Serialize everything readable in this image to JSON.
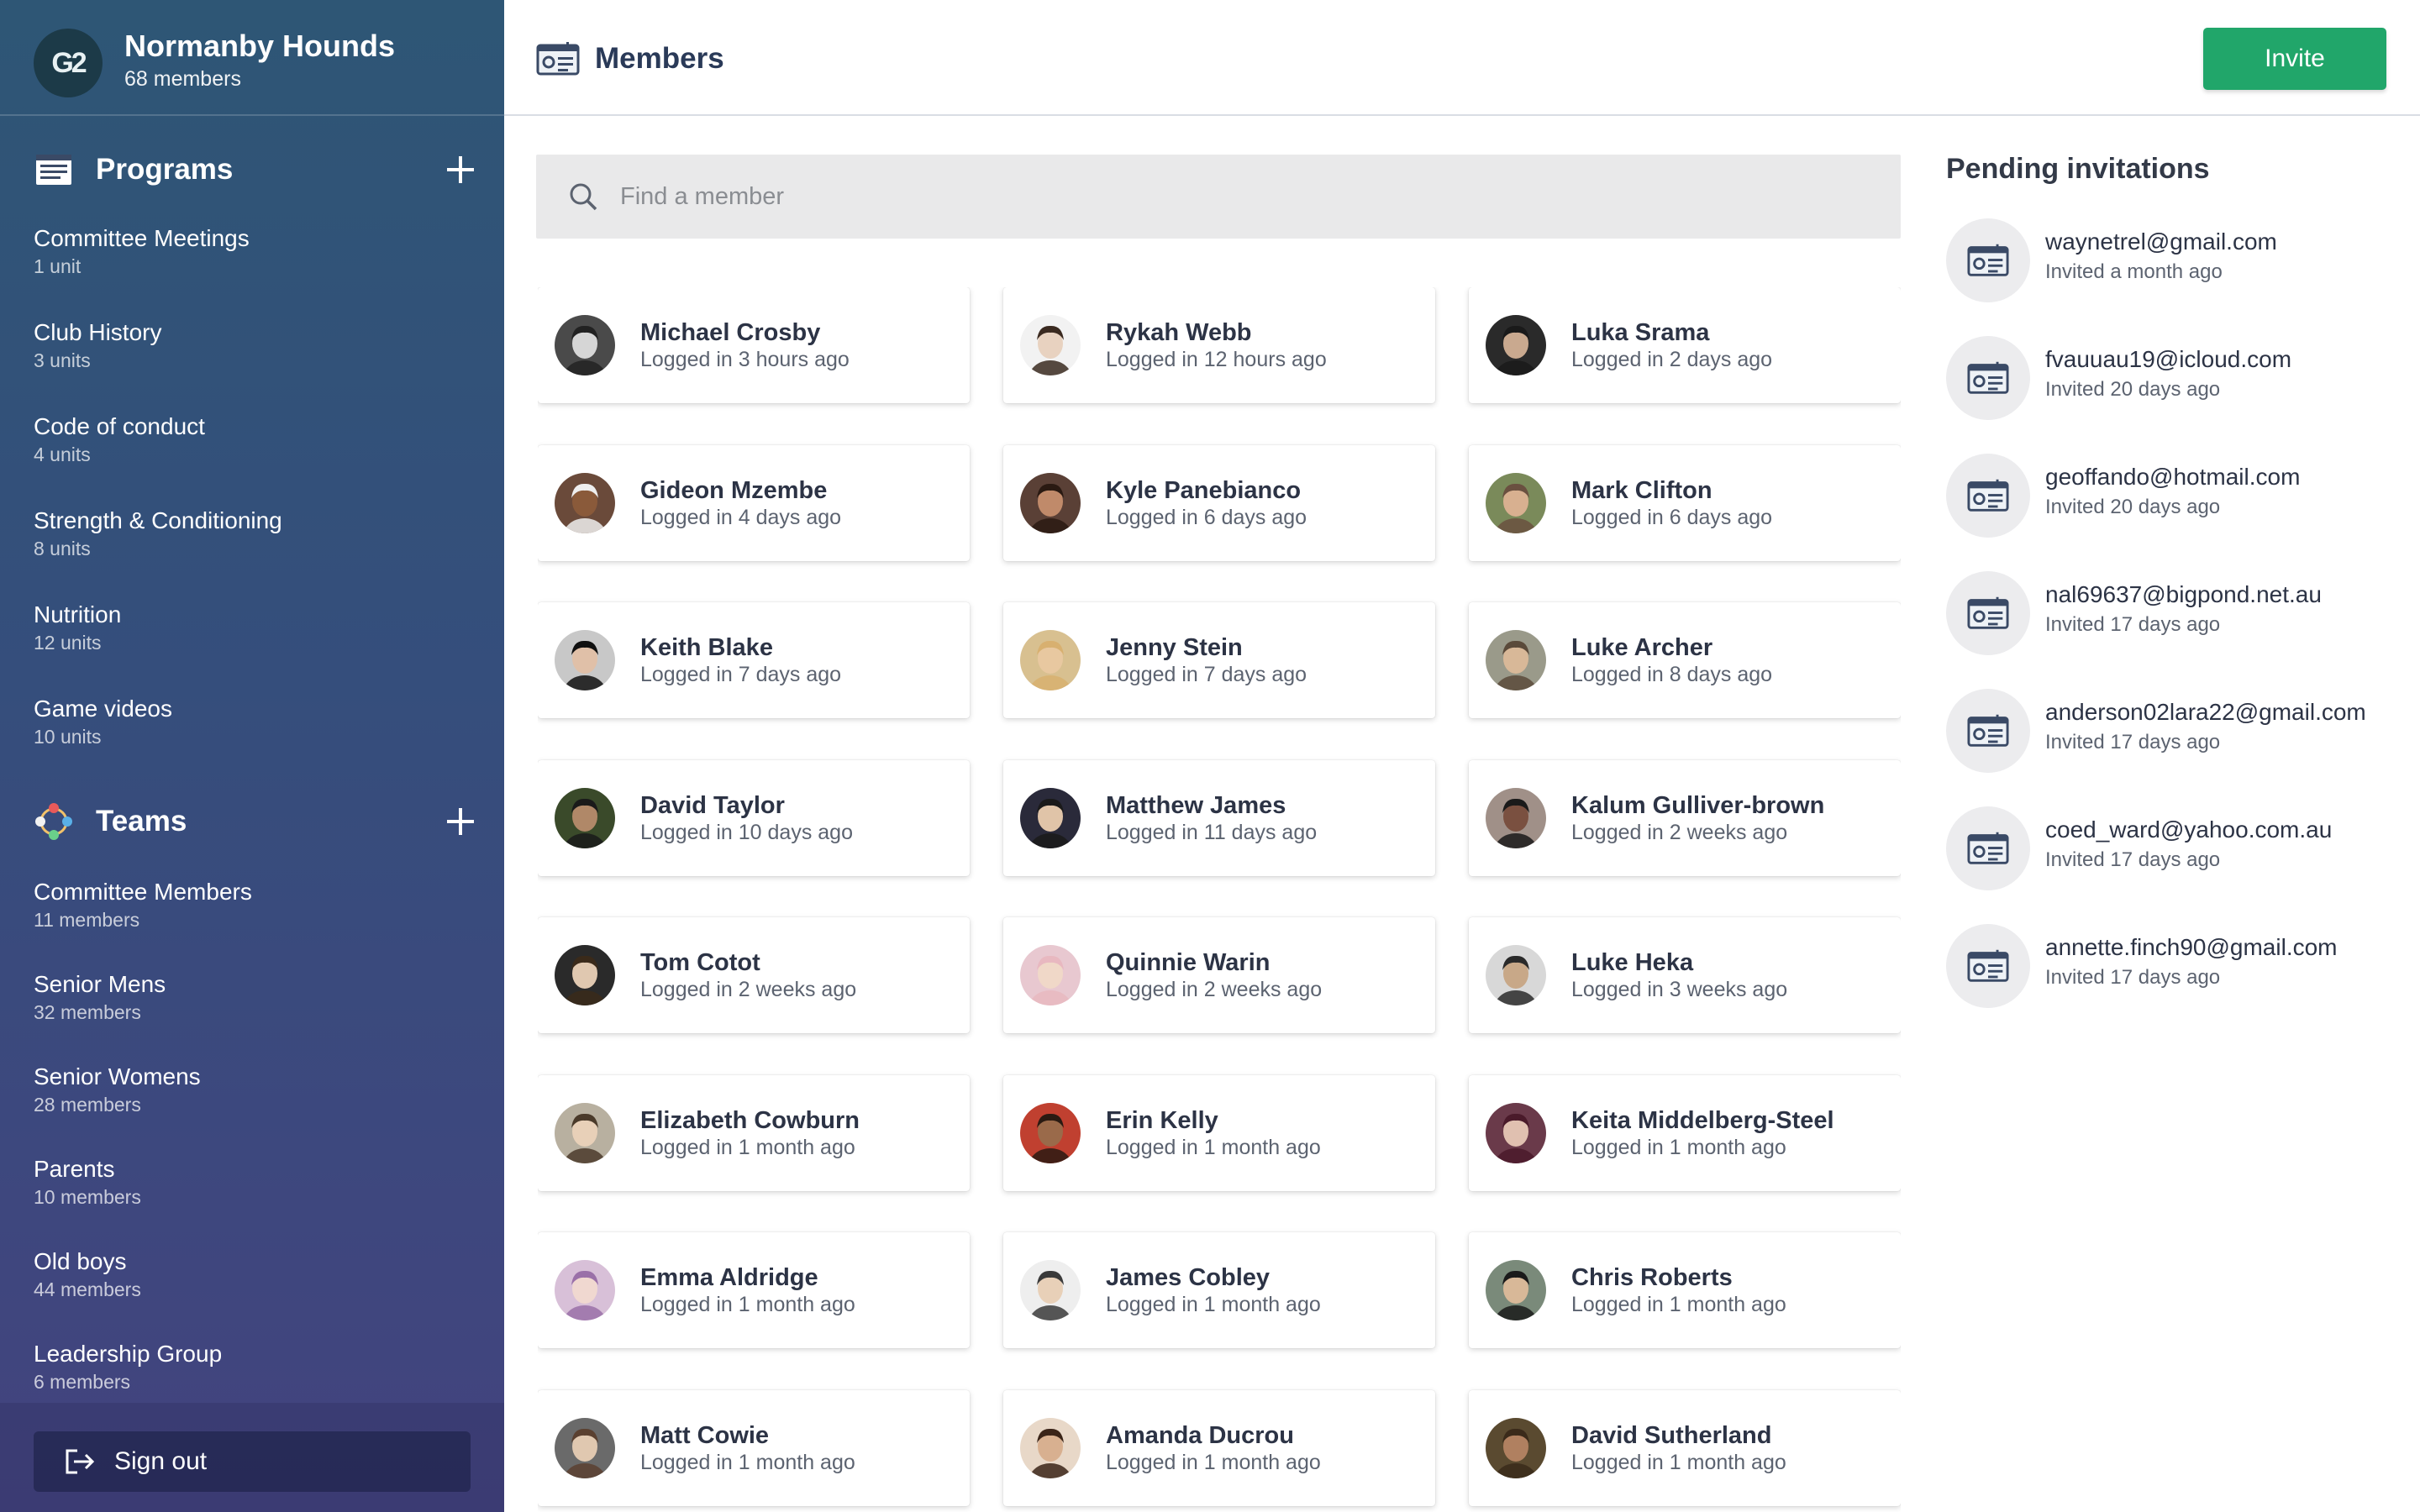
{
  "org": {
    "logo_text": "G2",
    "name": "Normanby Hounds",
    "member_count": "68 members"
  },
  "programs": {
    "title": "Programs",
    "items": [
      {
        "label": "Committee Meetings",
        "sub": "1 unit"
      },
      {
        "label": "Club History",
        "sub": "3 units"
      },
      {
        "label": "Code of conduct",
        "sub": "4 units"
      },
      {
        "label": "Strength & Conditioning",
        "sub": "8 units"
      },
      {
        "label": "Nutrition",
        "sub": "12 units"
      },
      {
        "label": "Game videos",
        "sub": "10 units"
      }
    ]
  },
  "teams": {
    "title": "Teams",
    "items": [
      {
        "label": "Committee Members",
        "sub": "11 members"
      },
      {
        "label": "Senior Mens",
        "sub": "32 members"
      },
      {
        "label": "Senior Womens",
        "sub": "28 members"
      },
      {
        "label": "Parents",
        "sub": "10 members"
      },
      {
        "label": "Old boys",
        "sub": "44 members"
      },
      {
        "label": "Leadership Group",
        "sub": "6 members"
      }
    ]
  },
  "signout_label": "Sign out",
  "header": {
    "title": "Members",
    "invite_label": "Invite"
  },
  "search": {
    "placeholder": "Find a member"
  },
  "members": [
    {
      "name": "Michael Crosby",
      "sub": "Logged in 3 hours ago",
      "skin": "#d6d6d6",
      "hair": "#222222",
      "bg": "#4a4a4a"
    },
    {
      "name": "Rykah Webb",
      "sub": "Logged in 12 hours ago",
      "skin": "#e8d2c0",
      "hair": "#3a2a20",
      "bg": "#f2f2f2"
    },
    {
      "name": "Luka Srama",
      "sub": "Logged in 2 days ago",
      "skin": "#c9a98f",
      "hair": "#1a1a1a",
      "bg": "#2a2a2a"
    },
    {
      "name": "Gideon Mzembe",
      "sub": "Logged in 4 days ago",
      "skin": "#8a5a3a",
      "hair": "#eeeeee",
      "bg": "#6a4a3a"
    },
    {
      "name": "Kyle Panebianco",
      "sub": "Logged in 6 days ago",
      "skin": "#c08a6a",
      "hair": "#2a1a12",
      "bg": "#5a4036"
    },
    {
      "name": "Mark Clifton",
      "sub": "Logged in 6 days ago",
      "skin": "#d8b090",
      "hair": "#6a5040",
      "bg": "#7a8a5a"
    },
    {
      "name": "Keith Blake",
      "sub": "Logged in 7 days ago",
      "skin": "#e0c0a8",
      "hair": "#101010",
      "bg": "#c8c8c8"
    },
    {
      "name": "Jenny Stein",
      "sub": "Logged in 7 days ago",
      "skin": "#e8c8a0",
      "hair": "#d8b070",
      "bg": "#d8c090"
    },
    {
      "name": "Luke Archer",
      "sub": "Logged in 8 days ago",
      "skin": "#d8b898",
      "hair": "#5a4a3a",
      "bg": "#9a9a8a"
    },
    {
      "name": "David Taylor",
      "sub": "Logged in 10 days ago",
      "skin": "#b08868",
      "hair": "#1a1a1a",
      "bg": "#3a4a2a"
    },
    {
      "name": "Matthew James",
      "sub": "Logged in 11 days ago",
      "skin": "#e0c4a8",
      "hair": "#1a1a1a",
      "bg": "#2a2a3a"
    },
    {
      "name": "Kalum Gulliver-brown",
      "sub": "Logged in 2 weeks ago",
      "skin": "#7a5040",
      "hair": "#1a1a1a",
      "bg": "#a09088"
    },
    {
      "name": "Tom Cotot",
      "sub": "Logged in 2 weeks ago",
      "skin": "#e0c8b0",
      "hair": "#3a2a1a",
      "bg": "#2a2a2a"
    },
    {
      "name": "Quinnie Warin",
      "sub": "Logged in 2 weeks ago",
      "skin": "#f0d8c8",
      "hair": "#e8b8c0",
      "bg": "#e8c8d0"
    },
    {
      "name": "Luke Heka",
      "sub": "Logged in 3 weeks ago",
      "skin": "#c8a888",
      "hair": "#2a2a2a",
      "bg": "#d8d8d8"
    },
    {
      "name": "Elizabeth Cowburn",
      "sub": "Logged in 1 month ago",
      "skin": "#e8d0b8",
      "hair": "#4a3a2a",
      "bg": "#b8b0a0"
    },
    {
      "name": "Erin Kelly",
      "sub": "Logged in 1 month ago",
      "skin": "#9a6a4a",
      "hair": "#2a1a12",
      "bg": "#c04030"
    },
    {
      "name": "Keita Middelberg-Steel",
      "sub": "Logged in 1 month ago",
      "skin": "#e0c0b0",
      "hair": "#4a1a2a",
      "bg": "#6a3a4a"
    },
    {
      "name": "Emma Aldridge",
      "sub": "Logged in 1 month ago",
      "skin": "#f0d8d0",
      "hair": "#9a70a8",
      "bg": "#d8c0d8"
    },
    {
      "name": "James Cobley",
      "sub": "Logged in 1 month ago",
      "skin": "#e8d0b8",
      "hair": "#3a3a3a",
      "bg": "#eeeeee"
    },
    {
      "name": "Chris Roberts",
      "sub": "Logged in 1 month ago",
      "skin": "#d8b898",
      "hair": "#1a1a1a",
      "bg": "#7a8a7a"
    },
    {
      "name": "Matt Cowie",
      "sub": "Logged in 1 month ago",
      "skin": "#e0c8b0",
      "hair": "#5a4030",
      "bg": "#6a6a6a"
    },
    {
      "name": "Amanda Ducrou",
      "sub": "Logged in 1 month ago",
      "skin": "#d8b090",
      "hair": "#3a2418",
      "bg": "#e8d8c8"
    },
    {
      "name": "David Sutherland",
      "sub": "Logged in 1 month ago",
      "skin": "#b08060",
      "hair": "#3a2a1a",
      "bg": "#5a4a30"
    }
  ],
  "pending": {
    "title": "Pending invitations",
    "items": [
      {
        "email": "waynetrel@gmail.com",
        "sub": "Invited a month ago"
      },
      {
        "email": "fvauuau19@icloud.com",
        "sub": "Invited 20 days ago"
      },
      {
        "email": "geoffando@hotmail.com",
        "sub": "Invited 20 days ago"
      },
      {
        "email": "nal69637@bigpond.net.au",
        "sub": "Invited 17 days ago"
      },
      {
        "email": "anderson02lara22@gmail.com",
        "sub": "Invited 17 days ago"
      },
      {
        "email": "coed_ward@yahoo.com.au",
        "sub": "Invited 17 days ago"
      },
      {
        "email": "annette.finch90@gmail.com",
        "sub": "Invited 17 days ago"
      }
    ]
  },
  "colors": {
    "accent": "#21a66a",
    "sidebar_top": "#2e5675",
    "sidebar_bottom": "#43437f"
  }
}
